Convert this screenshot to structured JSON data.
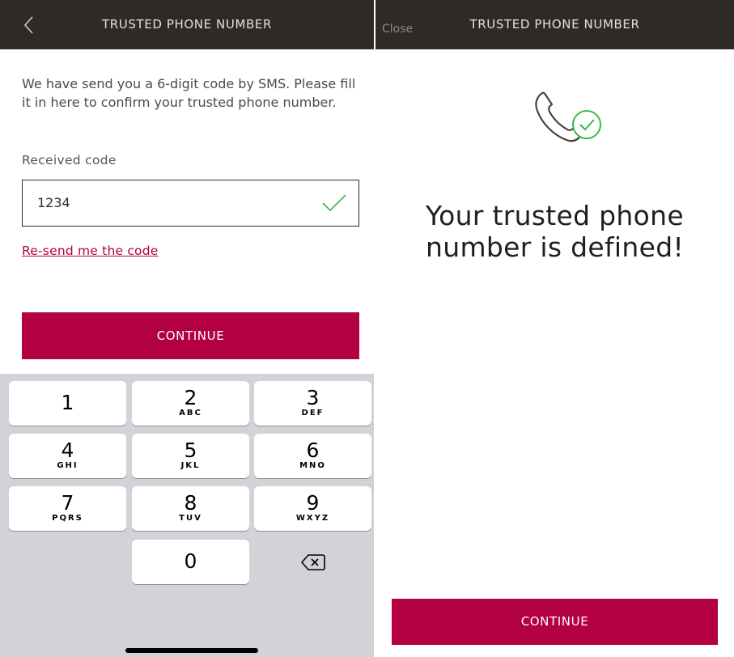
{
  "left_screen": {
    "header": {
      "title": "TRUSTED PHONE NUMBER",
      "back_icon": "chevron-left-icon"
    },
    "instruction": "We have send you a 6-digit code by SMS. Please fill it in here to confirm your trusted phone number.",
    "field": {
      "label": "Received code",
      "value": "1234",
      "valid_icon": "check-icon"
    },
    "resend_link": "Re-send me the code",
    "continue_label": "CONTINUE",
    "keypad": {
      "keys": [
        {
          "digit": "1",
          "letters": ""
        },
        {
          "digit": "2",
          "letters": "ABC"
        },
        {
          "digit": "3",
          "letters": "DEF"
        },
        {
          "digit": "4",
          "letters": "GHI"
        },
        {
          "digit": "5",
          "letters": "JKL"
        },
        {
          "digit": "6",
          "letters": "MNO"
        },
        {
          "digit": "7",
          "letters": "PQRS"
        },
        {
          "digit": "8",
          "letters": "TUV"
        },
        {
          "digit": "9",
          "letters": "WXYZ"
        },
        {
          "digit": "0",
          "letters": ""
        }
      ],
      "delete_icon": "backspace-icon"
    }
  },
  "right_screen": {
    "header": {
      "close_label": "Close",
      "title": "TRUSTED PHONE NUMBER"
    },
    "icon": "phone-check-icon",
    "message": "Your trusted phone number is defined!",
    "continue_label": "CONTINUE"
  },
  "colors": {
    "header_bg": "#2f2a28",
    "accent": "#b30042",
    "success": "#3cb54a",
    "keypad_bg": "#d1d3d9"
  }
}
